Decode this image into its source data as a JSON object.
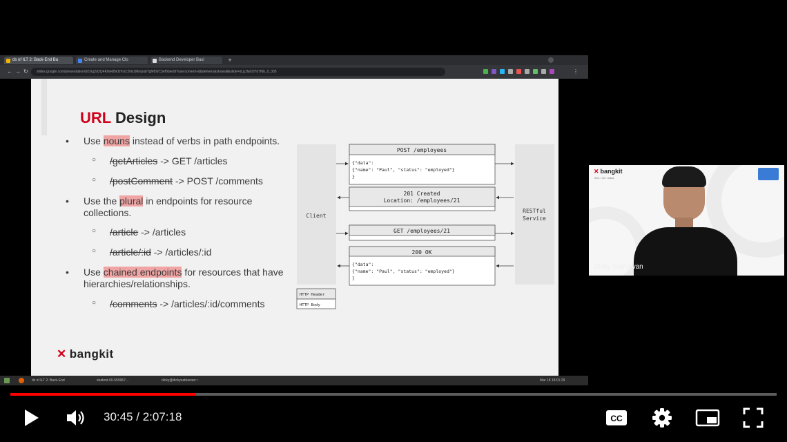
{
  "browser": {
    "tabs": [
      {
        "label": "ds of ILT 2: Back-End Ba"
      },
      {
        "label": "Create and Manage Clo"
      },
      {
        "label": "Backend Developer Basi"
      }
    ],
    "url": "slides.google.com/presentation/d/1Xg2d2QFKNe6Bk1Hn2c2Ns1Mn/pub?gf#89/C3ef9b/edit?usercontent-id&delivery&showall&slide=id.g1fa01f7d7f6b_0_305"
  },
  "slide": {
    "title_accent": "URL",
    "title_rest": " Design",
    "b1_pre": "Use ",
    "b1_hl": "nouns",
    "b1_post": " instead of verbs in path endpoints.",
    "s1_old": "/getArticles",
    "s1_new": " -> GET /articles",
    "s2_old": "/postComment",
    "s2_new": " -> POST /comments",
    "b2_pre": "Use the ",
    "b2_hl": "plural",
    "b2_post": " in endpoints for resource collections.",
    "s3_old": "/article",
    "s3_new": " -> /articles",
    "s4_old": "/article/:id",
    "s4_new": " -> /articles/:id",
    "b3_pre": "Use ",
    "b3_hl": "chained endpoints",
    "b3_post": " for resources that have hierarchies/relationships.",
    "s5_old": "/comments",
    "s5_new": " -> /articles/:id/comments",
    "logo": "bangkit"
  },
  "diagram": {
    "client": "Client",
    "service_line1": "RESTful",
    "service_line2": "Service",
    "req1_header": "POST /employees",
    "req1_body1": "{\"data\":",
    "req1_body2": "{\"name\": \"Paul\", \"status\": \"employed\"}",
    "req1_body3": "}",
    "res1_line1": "201 Created",
    "res1_line2": "Location: /employees/21",
    "req2_header": "GET /employees/21",
    "res2_header": "200 OK",
    "res2_body1": "{\"data\":",
    "res2_body2": "{\"name\": \"Paul\", \"status\": \"employed\"}",
    "res2_body3": "}",
    "legend_header": "HTTP Header",
    "legend_body": "HTTP Body"
  },
  "taskbar": {
    "items": [
      "ds of ILT 2: Back-End",
      "student-00-559967...",
      "dicky@dickysatriawan:~"
    ],
    "clock": "Mar 18 18:01:29"
  },
  "webcam": {
    "brand": "bangkit",
    "tagline": "ilmu • ini • masa",
    "presenter_name": "Dicky Satriawan"
  },
  "player": {
    "current_time": "30:45",
    "separator": " / ",
    "duration": "2:07:18",
    "progress_fraction": 0.242,
    "accent_color": "#ff0000"
  }
}
